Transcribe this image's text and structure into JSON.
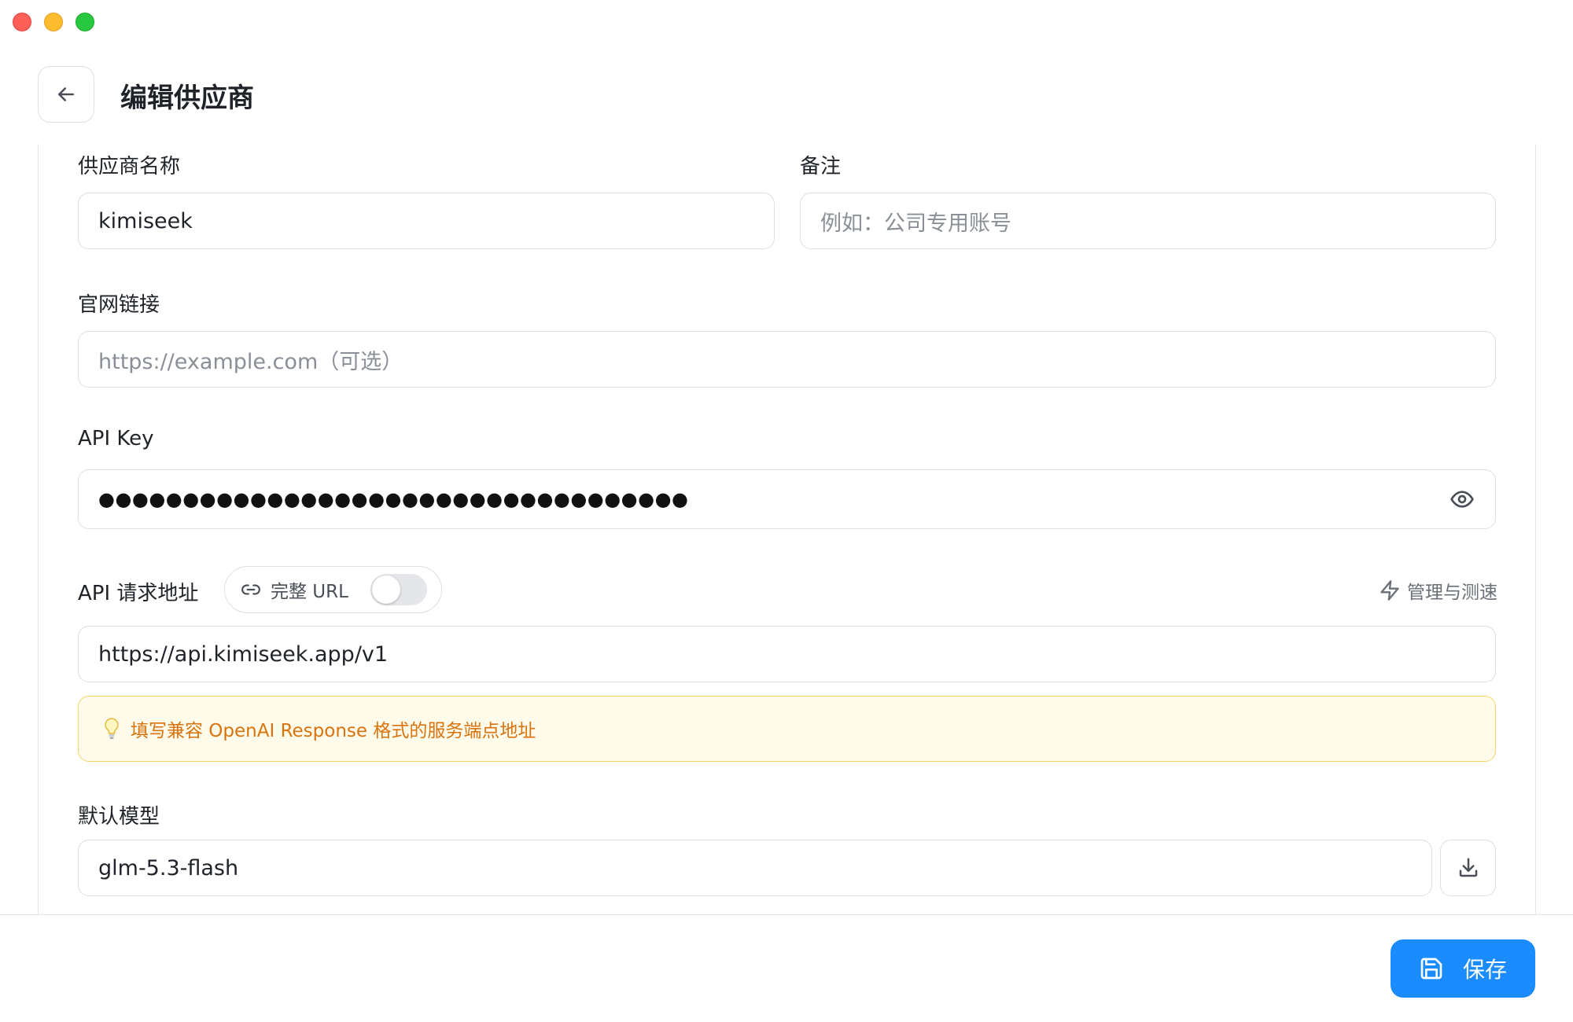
{
  "window": {
    "controls": [
      "close",
      "minimize",
      "zoom"
    ]
  },
  "header": {
    "title": "编辑供应商",
    "back_icon": "arrow-left-icon"
  },
  "form": {
    "provider_name": {
      "label": "供应商名称",
      "value": "kimiseek"
    },
    "note": {
      "label": "备注",
      "placeholder": "例如：公司专用账号"
    },
    "website": {
      "label": "官网链接",
      "placeholder": "https://example.com（可选）"
    },
    "api_key": {
      "label": "API Key",
      "masked_value": "●●●●●●●●●●●●●●●●●●●●●●●●●●●●●●●●●●●",
      "eye_icon": "eye-icon"
    },
    "api_url": {
      "label": "API 请求地址",
      "full_url_toggle_label": "完整 URL",
      "full_url_enabled": false,
      "manage_label": "管理与测速",
      "value": "https://api.kimiseek.app/v1",
      "tip": "填写兼容 OpenAI Response 格式的服务端点地址"
    },
    "default_model": {
      "label": "默认模型",
      "value": "glm-5.3-flash",
      "fetch_icon": "download-icon"
    }
  },
  "footer": {
    "save_label": "保存",
    "save_icon": "floppy-disk-icon"
  },
  "colors": {
    "primary": "#1a8cff",
    "tip_bg": "#fffbea",
    "tip_border": "#f7d56b",
    "tip_text": "#d9730d"
  }
}
